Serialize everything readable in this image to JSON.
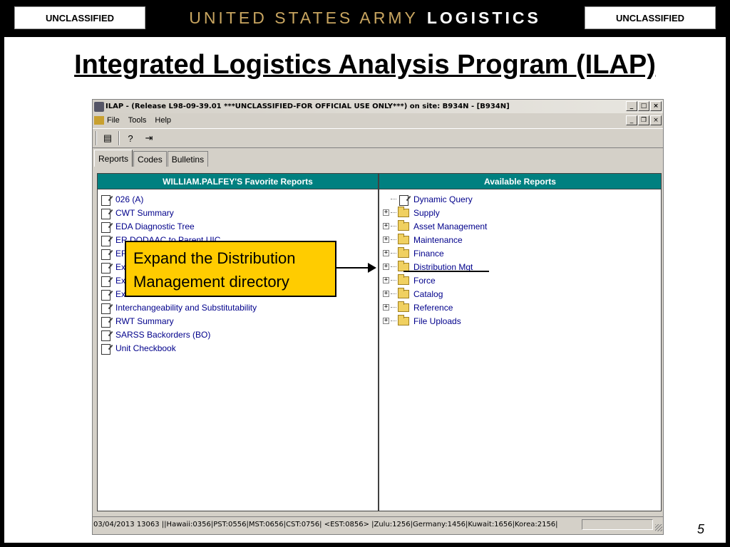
{
  "banner": {
    "left_label": "UNCLASSIFIED",
    "right_label": "UNCLASSIFIED",
    "org_title_light": "UNITED STATES ARMY",
    "org_title_bold": "LOGISTICS"
  },
  "slide": {
    "title": "Integrated Logistics Analysis Program (ILAP)",
    "page_number": "5"
  },
  "app": {
    "window_title": "ILAP - (Release L98-09-39.01 ***UNCLASSIFIED-FOR OFFICIAL USE ONLY***) on site: B934N - [B934N]",
    "menu": [
      "File",
      "Tools",
      "Help"
    ],
    "tabs": [
      "Reports",
      "Codes",
      "Bulletins"
    ],
    "favorites_header": "WILLIAM.PALFEY'S Favorite Reports",
    "favorites": [
      "026 (A)",
      "CWT Summary",
      "EDA Diagnostic Tree",
      "ER DODAAC to Parent UIC",
      "EF",
      "Ex",
      "Ex",
      "Ex",
      "Interchangeability and Substitutability",
      "RWT Summary",
      "SARSS Backorders (BO)",
      "Unit Checkbook"
    ],
    "available_header": "Available Reports",
    "available": [
      {
        "label": "Dynamic Query",
        "type": "doc"
      },
      {
        "label": "Supply",
        "type": "folder"
      },
      {
        "label": "Asset Management",
        "type": "folder"
      },
      {
        "label": "Maintenance",
        "type": "folder"
      },
      {
        "label": "Finance",
        "type": "folder"
      },
      {
        "label": "Distribution Mgt",
        "type": "folder"
      },
      {
        "label": "Force",
        "type": "folder"
      },
      {
        "label": "Catalog",
        "type": "folder"
      },
      {
        "label": "Reference",
        "type": "folder"
      },
      {
        "label": "File Uploads",
        "type": "folder"
      }
    ],
    "status_text": "03/04/2013 13063 ||Hawaii:0356|PST:0556|MST:0656|CST:0756| <EST:0856> |Zulu:1256|Germany:1456|Kuwait:1656|Korea:2156|"
  },
  "callout": {
    "text": "Expand the Distribution Management directory"
  }
}
